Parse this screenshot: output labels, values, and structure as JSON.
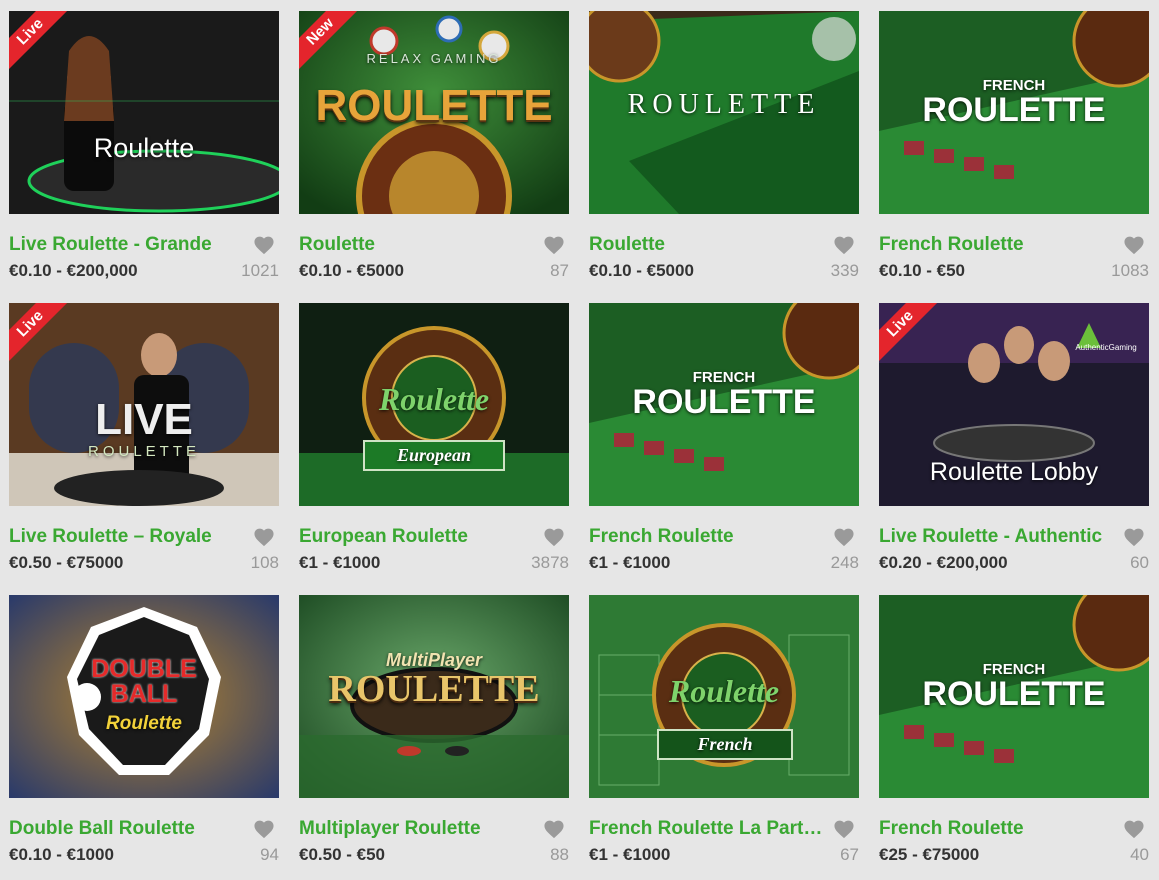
{
  "colors": {
    "accent": "#3aa832",
    "badge": "#e4252c",
    "background": "#e6e6e6"
  },
  "games": [
    {
      "name": "Live Roulette - Grande",
      "stake": "€0.10 - €200,000",
      "likes": "1021",
      "badge": "Live",
      "thumb_text": "Roulette",
      "thumb_sub": ""
    },
    {
      "name": "Roulette",
      "stake": "€0.10 - €5000",
      "likes": "87",
      "badge": "New",
      "thumb_text": "ROULETTE",
      "thumb_sub": "RELAX GAMING"
    },
    {
      "name": "Roulette",
      "stake": "€0.10 - €5000",
      "likes": "339",
      "badge": "",
      "thumb_text": "ROULETTE",
      "thumb_sub": ""
    },
    {
      "name": "French Roulette",
      "stake": "€0.10 - €50",
      "likes": "1083",
      "badge": "",
      "thumb_text": "ROULETTE",
      "thumb_sub": "FRENCH"
    },
    {
      "name": "Live Roulette – Royale",
      "stake": "€0.50 - €75000",
      "likes": "108",
      "badge": "Live",
      "thumb_text": "LIVE",
      "thumb_sub": "ROULETTE"
    },
    {
      "name": "European Roulette",
      "stake": "€1 - €1000",
      "likes": "3878",
      "badge": "",
      "thumb_text": "Roulette",
      "thumb_sub": "European"
    },
    {
      "name": "French Roulette",
      "stake": "€1 - €1000",
      "likes": "248",
      "badge": "",
      "thumb_text": "ROULETTE",
      "thumb_sub": "FRENCH"
    },
    {
      "name": "Live Roulette - Authentic",
      "stake": "€0.20 - €200,000",
      "likes": "60",
      "badge": "Live",
      "thumb_text": "Roulette Lobby",
      "thumb_sub": "AuthenticGaming"
    },
    {
      "name": "Double Ball Roulette",
      "stake": "€0.10 - €1000",
      "likes": "94",
      "badge": "",
      "thumb_text": "DOUBLE BALL",
      "thumb_sub": "Roulette"
    },
    {
      "name": "Multiplayer Roulette",
      "stake": "€0.50 - €50",
      "likes": "88",
      "badge": "",
      "thumb_text": "ROULETTE",
      "thumb_sub": "MultiPlayer"
    },
    {
      "name": "French Roulette La Partage",
      "stake": "€1 - €1000",
      "likes": "67",
      "badge": "",
      "thumb_text": "Roulette",
      "thumb_sub": "French"
    },
    {
      "name": "French Roulette",
      "stake": "€25 - €75000",
      "likes": "40",
      "badge": "",
      "thumb_text": "ROULETTE",
      "thumb_sub": "FRENCH"
    }
  ]
}
